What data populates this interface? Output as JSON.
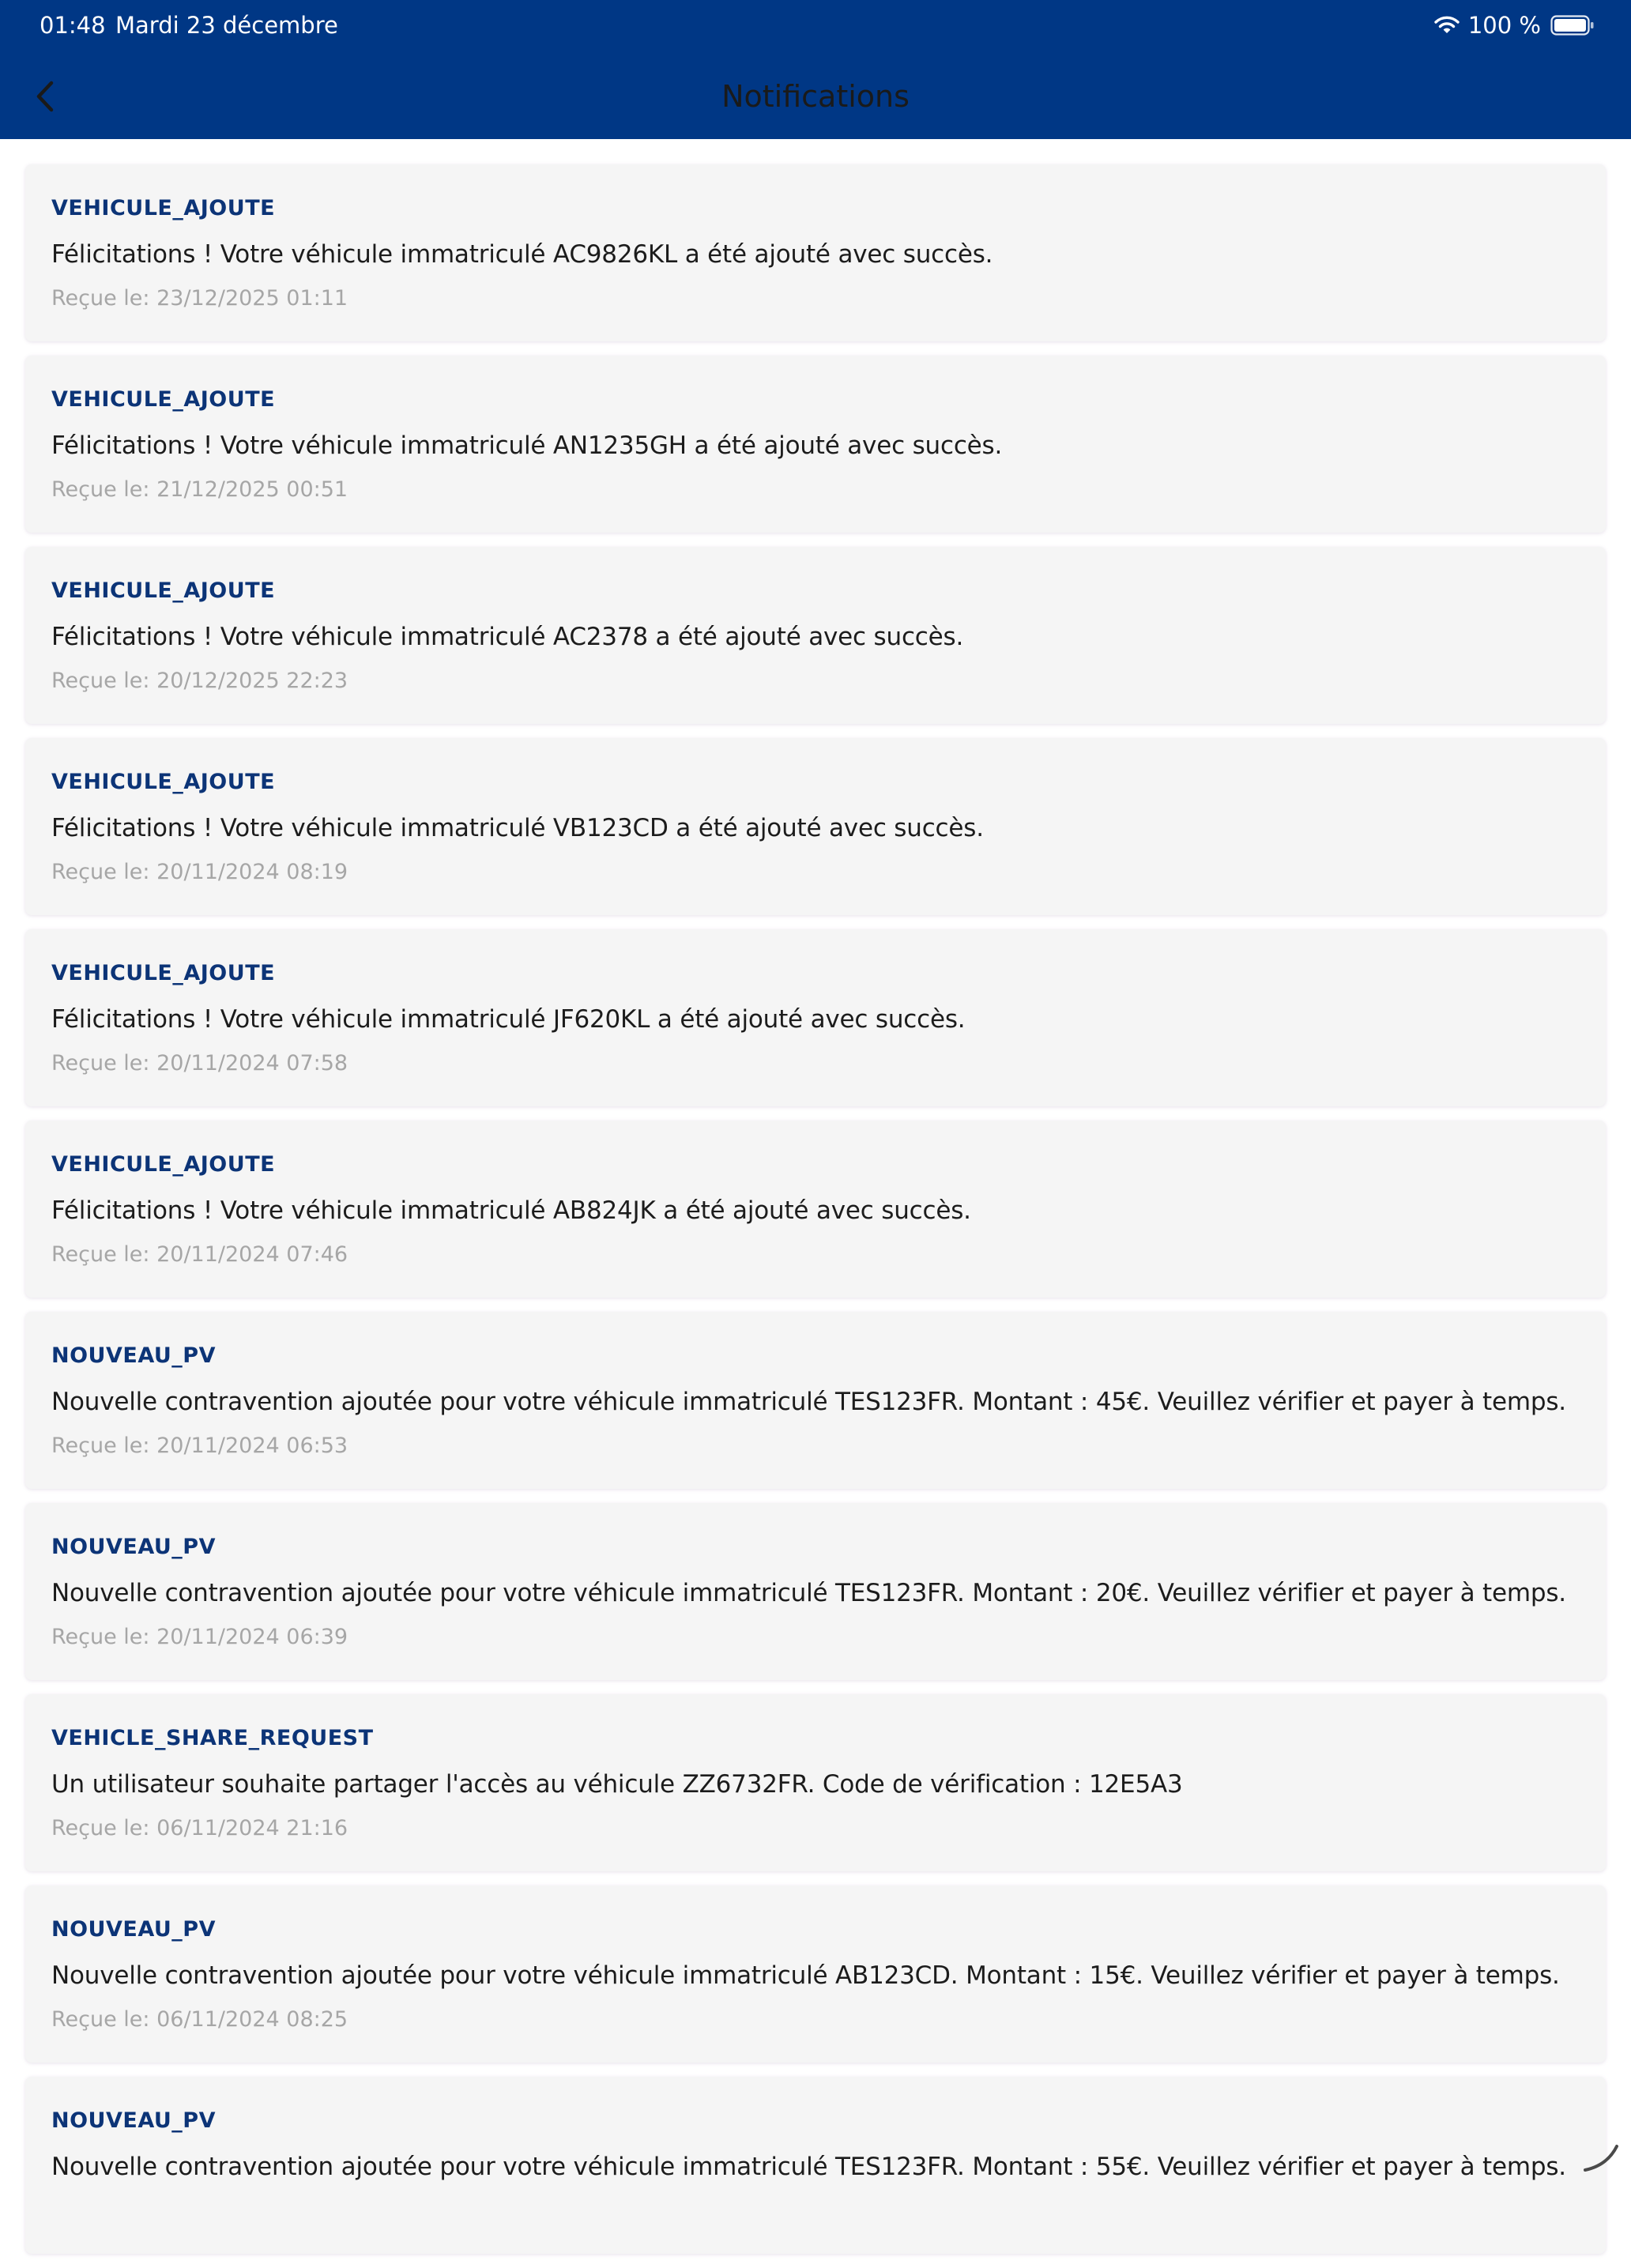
{
  "status_bar": {
    "time": "01:48",
    "date": "Mardi 23 décembre",
    "battery": "100 %"
  },
  "header": {
    "title": "Notifications",
    "background": "#003785"
  },
  "notifications": [
    {
      "type": "VEHICULE_AJOUTE",
      "message": "Félicitations ! Votre véhicule immatriculé AC9826KL a été ajouté avec succès.",
      "received": "Reçue le: 23/12/2025 01:11"
    },
    {
      "type": "VEHICULE_AJOUTE",
      "message": "Félicitations ! Votre véhicule immatriculé AN1235GH a été ajouté avec succès.",
      "received": "Reçue le: 21/12/2025 00:51"
    },
    {
      "type": "VEHICULE_AJOUTE",
      "message": "Félicitations ! Votre véhicule immatriculé AC2378 a été ajouté avec succès.",
      "received": "Reçue le: 20/12/2025 22:23"
    },
    {
      "type": "VEHICULE_AJOUTE",
      "message": "Félicitations ! Votre véhicule immatriculé VB123CD a été ajouté avec succès.",
      "received": "Reçue le: 20/11/2024 08:19"
    },
    {
      "type": "VEHICULE_AJOUTE",
      "message": "Félicitations ! Votre véhicule immatriculé JF620KL a été ajouté avec succès.",
      "received": "Reçue le: 20/11/2024 07:58"
    },
    {
      "type": "VEHICULE_AJOUTE",
      "message": "Félicitations ! Votre véhicule immatriculé AB824JK a été ajouté avec succès.",
      "received": "Reçue le: 20/11/2024 07:46"
    },
    {
      "type": "NOUVEAU_PV",
      "message": "Nouvelle contravention ajoutée pour votre véhicule immatriculé TES123FR. Montant : 45€. Veuillez vérifier et payer à temps.",
      "received": "Reçue le: 20/11/2024 06:53"
    },
    {
      "type": "NOUVEAU_PV",
      "message": "Nouvelle contravention ajoutée pour votre véhicule immatriculé TES123FR. Montant : 20€. Veuillez vérifier et payer à temps.",
      "received": "Reçue le: 20/11/2024 06:39"
    },
    {
      "type": "VEHICLE_SHARE_REQUEST",
      "message": "Un utilisateur souhaite partager l'accès au véhicule ZZ6732FR. Code de vérification : 12E5A3",
      "received": "Reçue le: 06/11/2024 21:16"
    },
    {
      "type": "NOUVEAU_PV",
      "message": "Nouvelle contravention ajoutée pour votre véhicule immatriculé AB123CD. Montant : 15€. Veuillez vérifier et payer à temps.",
      "received": "Reçue le: 06/11/2024 08:25"
    },
    {
      "type": "NOUVEAU_PV",
      "message": "Nouvelle contravention ajoutée pour votre véhicule immatriculé TES123FR. Montant : 55€. Veuillez vérifier et payer à temps.",
      "received": ""
    }
  ],
  "colors": {
    "type_label": "#0c3477",
    "date_text": "#a6a6a6",
    "card_background": "#f5f5f5"
  },
  "icons": {
    "back": "chevron-left-icon",
    "wifi": "wifi-icon",
    "battery": "battery-icon"
  }
}
